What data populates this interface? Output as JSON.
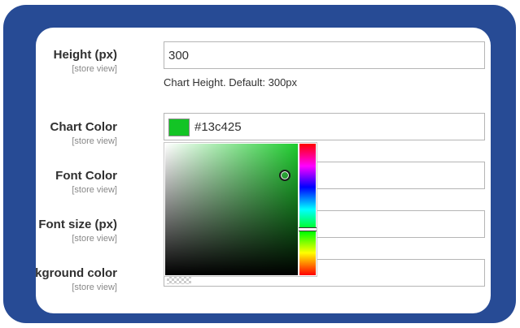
{
  "height": {
    "label": "Height (px)",
    "scope": "[store view]",
    "value": "300",
    "note": "Chart Height. Default: 300px"
  },
  "chart_color": {
    "label": "Chart Color",
    "scope": "[store view]",
    "value": "#13c425",
    "swatch_color": "#13c425"
  },
  "font_color": {
    "label": "Font Color",
    "scope": "[store view]",
    "value": ""
  },
  "font_size": {
    "label": "Font size (px)",
    "scope": "[store view]",
    "value": ""
  },
  "background_color": {
    "label": "Background color",
    "scope": "[store view]",
    "value": ""
  },
  "picker": {
    "hue_color": "#1fcc2f"
  }
}
